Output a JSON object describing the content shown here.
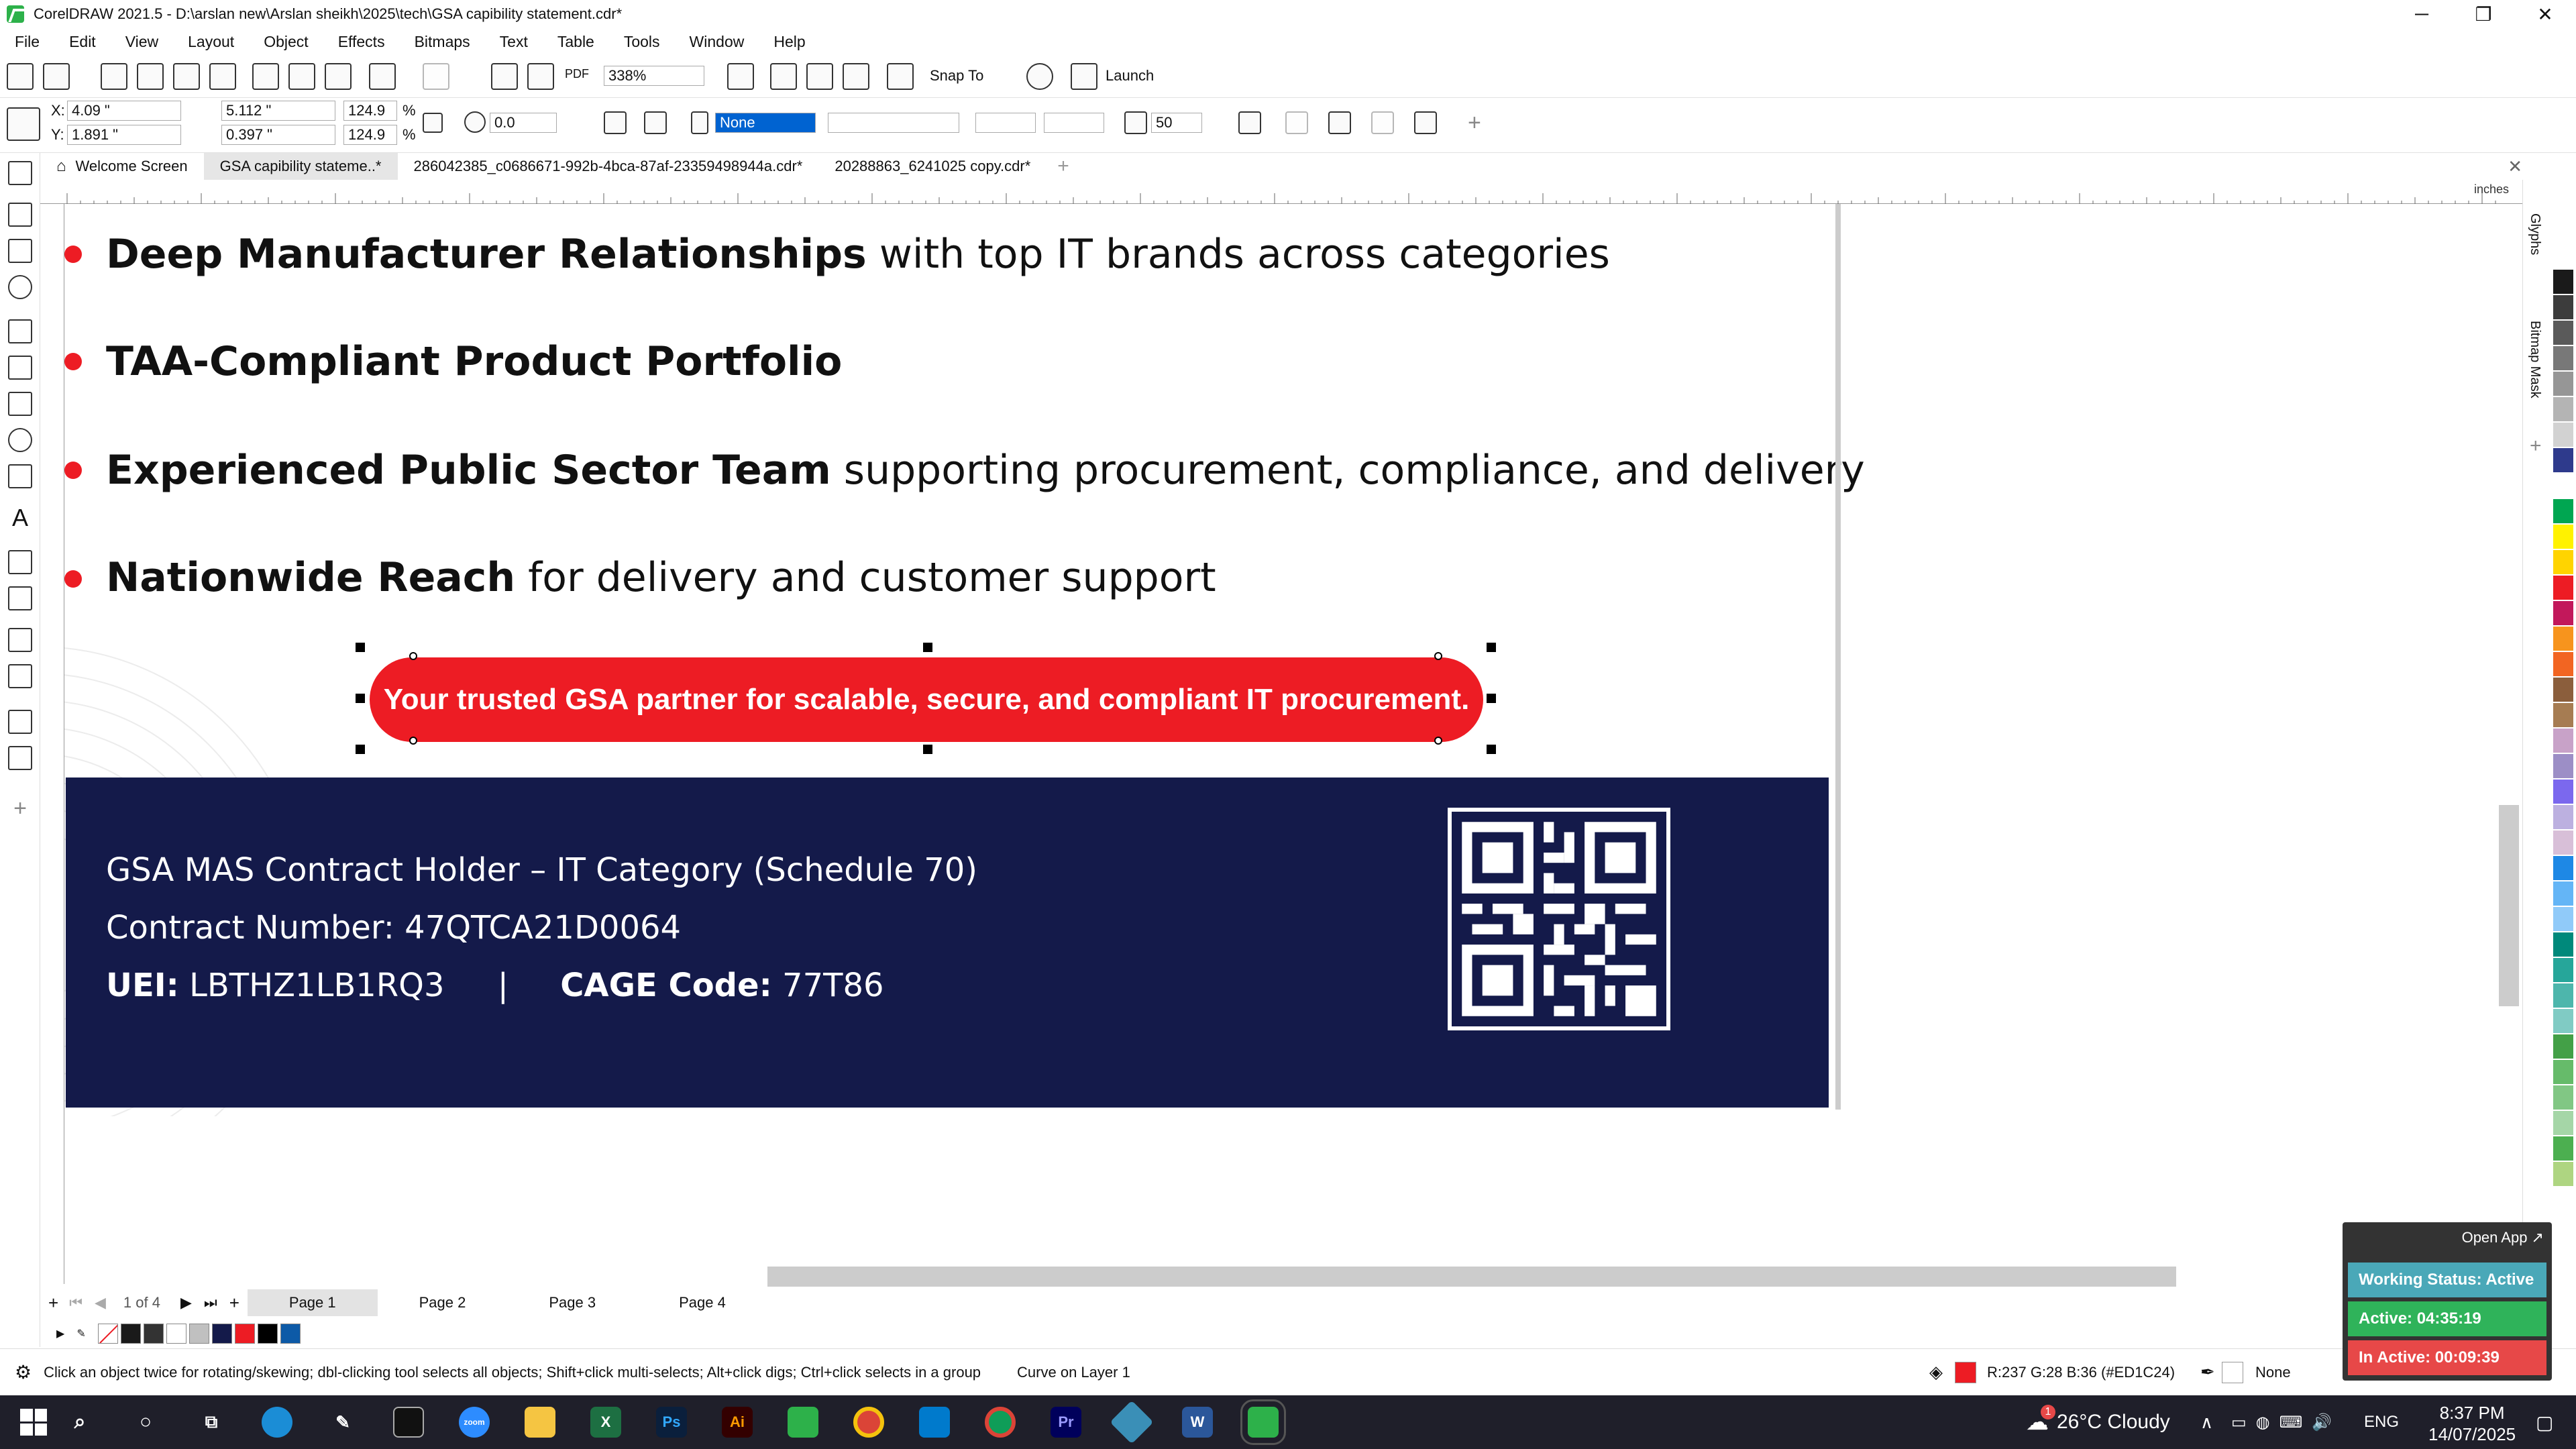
{
  "window": {
    "title": "CorelDRAW 2021.5 - D:\\arslan new\\Arslan sheikh\\2025\\tech\\GSA  capibility statement.cdr*",
    "controls": [
      "─",
      "❐",
      "✕"
    ]
  },
  "menu": [
    "File",
    "Edit",
    "View",
    "Layout",
    "Object",
    "Effects",
    "Bitmaps",
    "Text",
    "Table",
    "Tools",
    "Window",
    "Help"
  ],
  "toolbar": {
    "zoom": "338%",
    "snap_label": "Snap To",
    "launch_label": "Launch",
    "pdf_label": "PDF"
  },
  "property_bar": {
    "x": "4.09 \"",
    "y": "1.891 \"",
    "width": "5.112 \"",
    "height": "0.397 \"",
    "scale_w": "124.9",
    "scale_h": "124.9",
    "percent": "%",
    "x_label": "X:",
    "y_label": "Y:",
    "rotation": "0.0",
    "outline_fill": "None",
    "smoothing": "50"
  },
  "doc_tabs": [
    {
      "label": "Welcome Screen",
      "active": false
    },
    {
      "label": "GSA  capibility stateme..*",
      "active": true
    },
    {
      "label": "286042385_c0686671-992b-4bca-87af-23359498944a.cdr*",
      "active": false
    },
    {
      "label": "20288863_6241025 copy.cdr*",
      "active": false
    }
  ],
  "ruler_unit": "inches",
  "canvas": {
    "bullets": [
      {
        "bold": "Deep Manufacturer Relationships",
        "rest": " with top IT brands across categories"
      },
      {
        "bold": "TAA-Compliant Product Portfolio",
        "rest": ""
      },
      {
        "bold": "Experienced Public Sector Team",
        "rest": " supporting procurement, compliance, and delivery"
      },
      {
        "bold": "Nationwide Reach",
        "rest": " for delivery and customer support"
      }
    ],
    "banner_text": "Your trusted GSA partner for scalable, secure, and compliant IT procurement.",
    "footer": {
      "line1": "GSA MAS Contract Holder – IT Category (Schedule 70)",
      "line2": "Contract Number: 47QTCA21D0064",
      "uei_label": "UEI:",
      "uei_value": " LBTHZ1LB1RQ3",
      "separator": "|",
      "cage_label": "CAGE Code:",
      "cage_value": " 77T86"
    }
  },
  "docker_tabs": [
    "Glyphs",
    "Bitmap Mask"
  ],
  "pages": {
    "counter": "1 of 4",
    "tabs": [
      "Page 1",
      "Page 2",
      "Page 3",
      "Page 4"
    ],
    "active": "Page 1"
  },
  "status": {
    "hint": "Click an object twice for rotating/skewing; dbl-clicking tool selects all objects; Shift+click multi-selects; Alt+click digs; Ctrl+click selects in a group",
    "object_info": "Curve on Layer 1",
    "fill_info": "R:237 G:28 B:36 (#ED1C24)",
    "outline_info": "None"
  },
  "widget": {
    "open_app": "Open App ↗",
    "working_status": "Working Status: Active",
    "active_time": "Active: 04:35:19",
    "inactive_time": "In Active: 00:09:39"
  },
  "taskbar": {
    "weather": "26°C  Cloudy",
    "language": "ENG",
    "time": "8:37 PM",
    "date": "14/07/2025",
    "badge": "1"
  },
  "colors": {
    "accent_red": "#ed1c24",
    "navy": "#141a4a",
    "widget_green": "#2fb35a",
    "widget_red": "#e74848",
    "palette": [
      "#ffffff",
      "#1a1a1a",
      "#3c3c3c",
      "#5a5a5a",
      "#787878",
      "#969696",
      "#b4b4b4",
      "#d2d2d2",
      "#2e3a8c",
      "#ffffff",
      "#00a651",
      "#fff200",
      "#ffd400",
      "#ed1c24",
      "#c2185b",
      "#f7941d",
      "#f26522",
      "#8b5e3c",
      "#a67c52",
      "#c8a2c8",
      "#9c8ec6",
      "#7b68ee",
      "#bcb0e0",
      "#d8bfd8",
      "#1e88e5",
      "#64b5f6",
      "#90caf9",
      "#00897b",
      "#26a69a",
      "#4db6ac",
      "#80cbc4",
      "#43a047",
      "#66bb6a",
      "#81c784",
      "#a5d6a7",
      "#4caf50",
      "#aed581"
    ]
  }
}
